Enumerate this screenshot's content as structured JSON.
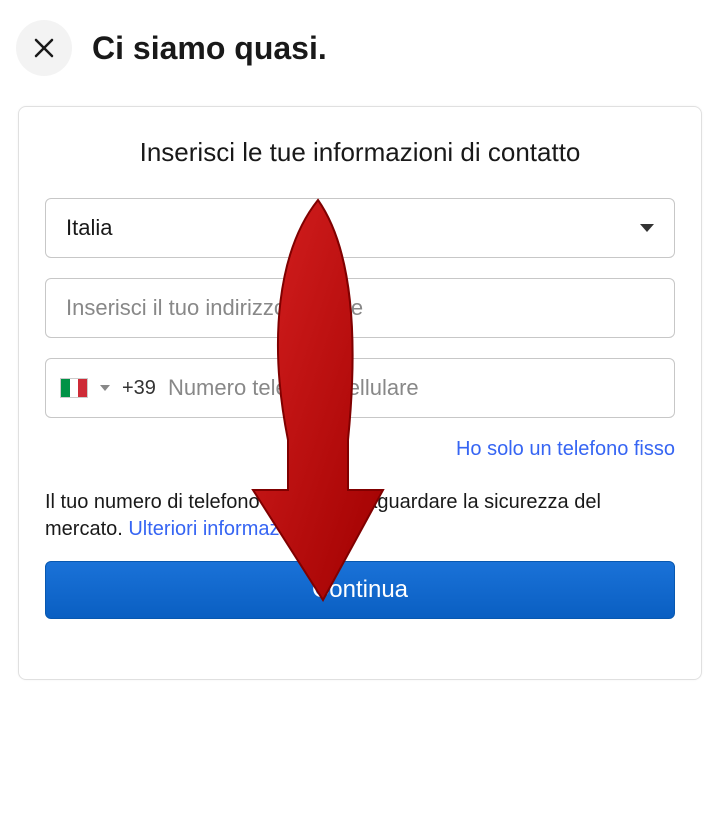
{
  "header": {
    "title": "Ci siamo quasi."
  },
  "card": {
    "title": "Inserisci le tue informazioni di contatto",
    "country_select": "Italia",
    "address_placeholder": "Inserisci il tuo indirizzo postale",
    "dial_code": "+39",
    "phone_placeholder": "Numero telefono cellulare",
    "landline_link": "Ho solo un telefono fisso",
    "info_text": "Il tuo numero di telefono aiuta a salvaguardare la sicurezza del mercato. ",
    "info_link": "Ulteriori informazioni",
    "info_link_suffix": ".",
    "continue_label": "Continua"
  }
}
